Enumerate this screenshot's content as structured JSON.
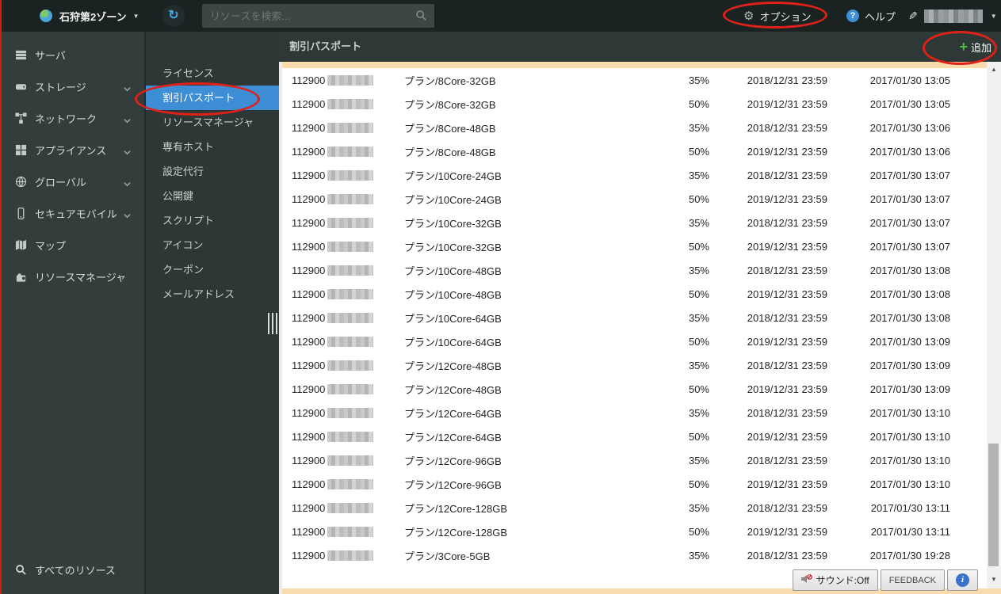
{
  "topbar": {
    "zone_label": "石狩第2ゾーン",
    "search_placeholder": "リソースを検索...",
    "options_label": "オプション",
    "help_label": "ヘルプ"
  },
  "sidebar": {
    "items": [
      {
        "label": "サーバ",
        "icon": "server-icon",
        "chevron": false
      },
      {
        "label": "ストレージ",
        "icon": "storage-icon",
        "chevron": true
      },
      {
        "label": "ネットワーク",
        "icon": "network-icon",
        "chevron": true
      },
      {
        "label": "アプライアンス",
        "icon": "appliance-icon",
        "chevron": true
      },
      {
        "label": "グローバル",
        "icon": "globe-icon",
        "chevron": true
      },
      {
        "label": "セキュアモバイル",
        "icon": "mobile-icon",
        "chevron": true
      },
      {
        "label": "マップ",
        "icon": "map-icon",
        "chevron": false
      },
      {
        "label": "リソースマネージャ",
        "icon": "puzzle-icon",
        "chevron": false
      }
    ],
    "all_resources_label": "すべてのリソース"
  },
  "subsidebar": {
    "items": [
      {
        "label": "ライセンス",
        "selected": false
      },
      {
        "label": "割引パスポート",
        "selected": true
      },
      {
        "label": "リソースマネージャ",
        "selected": false
      },
      {
        "label": "専有ホスト",
        "selected": false
      },
      {
        "label": "設定代行",
        "selected": false
      },
      {
        "label": "公開鍵",
        "selected": false
      },
      {
        "label": "スクリプト",
        "selected": false
      },
      {
        "label": "アイコン",
        "selected": false
      },
      {
        "label": "クーポン",
        "selected": false
      },
      {
        "label": "メールアドレス",
        "selected": false
      }
    ]
  },
  "main": {
    "title": "割引パスポート",
    "add_button_label": "追加"
  },
  "table": {
    "rows": [
      {
        "id_prefix": "112900",
        "plan": "プラン/8Core-32GB",
        "discount": "35%",
        "expires": "2018/12/31 23:59",
        "created": "2017/01/30 13:05"
      },
      {
        "id_prefix": "112900",
        "plan": "プラン/8Core-32GB",
        "discount": "50%",
        "expires": "2019/12/31 23:59",
        "created": "2017/01/30 13:05"
      },
      {
        "id_prefix": "112900",
        "plan": "プラン/8Core-48GB",
        "discount": "35%",
        "expires": "2018/12/31 23:59",
        "created": "2017/01/30 13:06"
      },
      {
        "id_prefix": "112900",
        "plan": "プラン/8Core-48GB",
        "discount": "50%",
        "expires": "2019/12/31 23:59",
        "created": "2017/01/30 13:06"
      },
      {
        "id_prefix": "112900",
        "plan": "プラン/10Core-24GB",
        "discount": "35%",
        "expires": "2018/12/31 23:59",
        "created": "2017/01/30 13:07"
      },
      {
        "id_prefix": "112900",
        "plan": "プラン/10Core-24GB",
        "discount": "50%",
        "expires": "2019/12/31 23:59",
        "created": "2017/01/30 13:07"
      },
      {
        "id_prefix": "112900",
        "plan": "プラン/10Core-32GB",
        "discount": "35%",
        "expires": "2018/12/31 23:59",
        "created": "2017/01/30 13:07"
      },
      {
        "id_prefix": "112900",
        "plan": "プラン/10Core-32GB",
        "discount": "50%",
        "expires": "2019/12/31 23:59",
        "created": "2017/01/30 13:07"
      },
      {
        "id_prefix": "112900",
        "plan": "プラン/10Core-48GB",
        "discount": "35%",
        "expires": "2018/12/31 23:59",
        "created": "2017/01/30 13:08"
      },
      {
        "id_prefix": "112900",
        "plan": "プラン/10Core-48GB",
        "discount": "50%",
        "expires": "2019/12/31 23:59",
        "created": "2017/01/30 13:08"
      },
      {
        "id_prefix": "112900",
        "plan": "プラン/10Core-64GB",
        "discount": "35%",
        "expires": "2018/12/31 23:59",
        "created": "2017/01/30 13:08"
      },
      {
        "id_prefix": "112900",
        "plan": "プラン/10Core-64GB",
        "discount": "50%",
        "expires": "2019/12/31 23:59",
        "created": "2017/01/30 13:09"
      },
      {
        "id_prefix": "112900",
        "plan": "プラン/12Core-48GB",
        "discount": "35%",
        "expires": "2018/12/31 23:59",
        "created": "2017/01/30 13:09"
      },
      {
        "id_prefix": "112900",
        "plan": "プラン/12Core-48GB",
        "discount": "50%",
        "expires": "2019/12/31 23:59",
        "created": "2017/01/30 13:09"
      },
      {
        "id_prefix": "112900",
        "plan": "プラン/12Core-64GB",
        "discount": "35%",
        "expires": "2018/12/31 23:59",
        "created": "2017/01/30 13:10"
      },
      {
        "id_prefix": "112900",
        "plan": "プラン/12Core-64GB",
        "discount": "50%",
        "expires": "2019/12/31 23:59",
        "created": "2017/01/30 13:10"
      },
      {
        "id_prefix": "112900",
        "plan": "プラン/12Core-96GB",
        "discount": "35%",
        "expires": "2018/12/31 23:59",
        "created": "2017/01/30 13:10"
      },
      {
        "id_prefix": "112900",
        "plan": "プラン/12Core-96GB",
        "discount": "50%",
        "expires": "2019/12/31 23:59",
        "created": "2017/01/30 13:10"
      },
      {
        "id_prefix": "112900",
        "plan": "プラン/12Core-128GB",
        "discount": "35%",
        "expires": "2018/12/31 23:59",
        "created": "2017/01/30 13:11"
      },
      {
        "id_prefix": "112900",
        "plan": "プラン/12Core-128GB",
        "discount": "50%",
        "expires": "2019/12/31 23:59",
        "created": "2017/01/30 13:11"
      },
      {
        "id_prefix": "112900",
        "plan": "プラン/3Core-5GB",
        "discount": "35%",
        "expires": "2018/12/31 23:59",
        "created": "2017/01/30 19:28"
      }
    ]
  },
  "footer": {
    "sound_label": "サウンド:Off",
    "feedback_label": "FEEDBACK"
  },
  "colors": {
    "selected_blue": "#3e8ed6",
    "accent_green": "#55b84e",
    "annotation_red": "#e0211a",
    "cream_strip": "#f9dcae"
  }
}
